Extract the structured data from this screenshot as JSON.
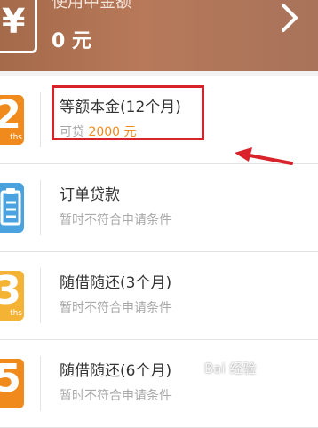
{
  "header": {
    "label": "使用中金额",
    "amount": "0 元"
  },
  "loans": [
    {
      "tile_num": "2",
      "tile_sub": "ths",
      "tile_color": "#f08a1c",
      "title": "等额本金(12个月)",
      "sub_prefix": "可贷 ",
      "sub_amount": "2000 元"
    },
    {
      "tile_color": "#4aa3df",
      "title": "订单贷款",
      "sub": "暂时不符合申请条件"
    },
    {
      "tile_num": "3",
      "tile_sub": "ths",
      "tile_color": "#f5b335",
      "title": "随借随还(3个月)",
      "sub": "暂时不符合申请条件"
    },
    {
      "tile_num": "5",
      "tile_color": "#f08a1c",
      "title": "随借随还(6个月)",
      "sub": "暂时不符合申请条件"
    }
  ],
  "annotation": {
    "color": "#d8232a"
  },
  "watermark": "Bai 经验"
}
